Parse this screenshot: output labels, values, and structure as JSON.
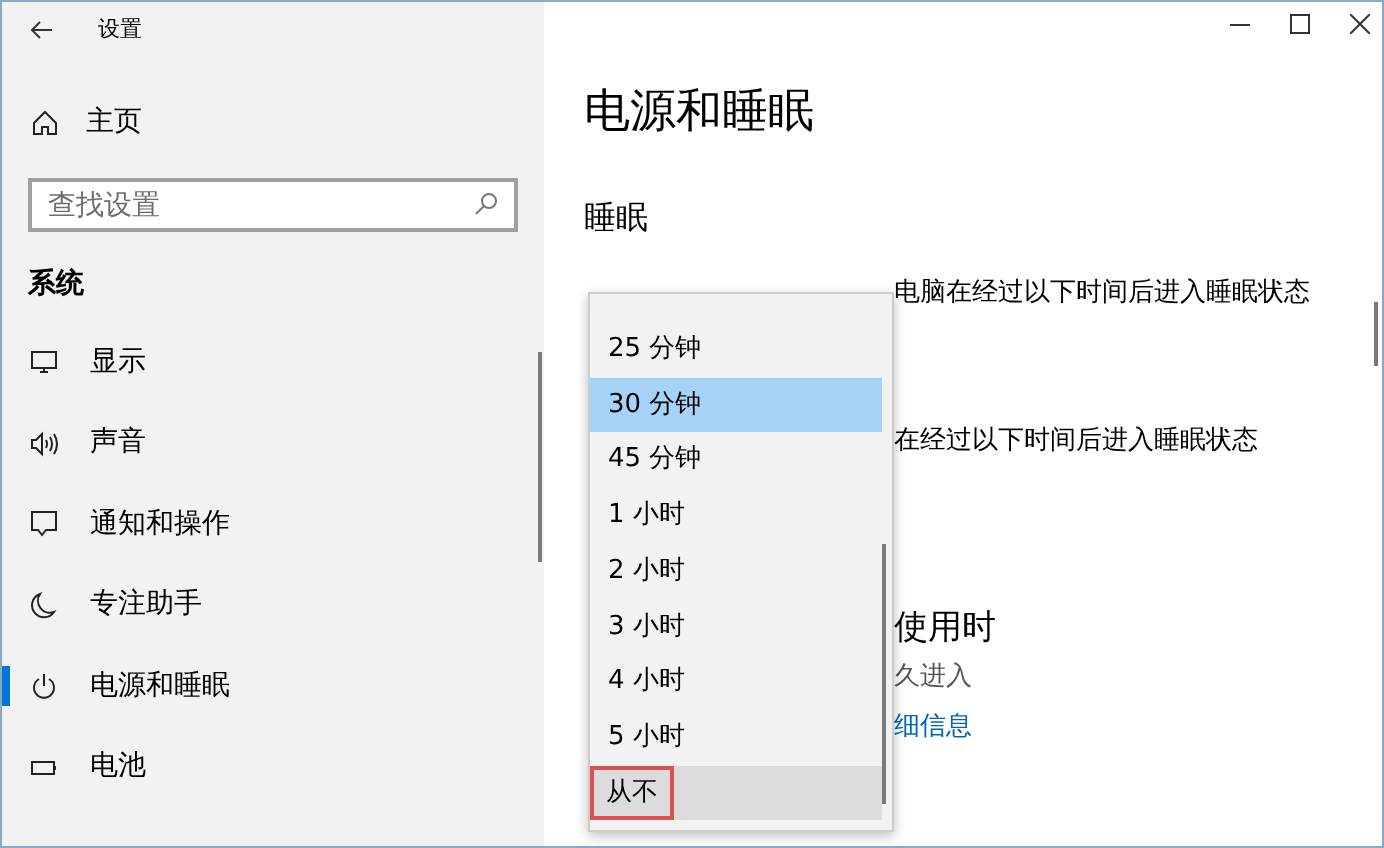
{
  "window": {
    "title": "设置"
  },
  "sidebar": {
    "home": "主页",
    "search": {
      "placeholder": "查找设置"
    },
    "section": "系统",
    "items": [
      {
        "label": "显示",
        "selected": false
      },
      {
        "label": "声音",
        "selected": false
      },
      {
        "label": "通知和操作",
        "selected": false
      },
      {
        "label": "专注助手",
        "selected": false
      },
      {
        "label": "电源和睡眠",
        "selected": true
      },
      {
        "label": "电池",
        "selected": false
      }
    ]
  },
  "main": {
    "title": "电源和睡眠",
    "section": "睡眠",
    "battery_text": "电脑在经过以下时间后进入睡眠状态",
    "plugged_text": "在经过以下时间后进入睡眠状态",
    "usage_heading": "使用时",
    "usage_text": "久进入",
    "link": "细信息"
  },
  "dropdown": {
    "options": [
      {
        "label": "25 分钟",
        "selected": false,
        "highlighted": false
      },
      {
        "label": "30 分钟",
        "selected": true,
        "highlighted": false
      },
      {
        "label": "45 分钟",
        "selected": false,
        "highlighted": false
      },
      {
        "label": "1 小时",
        "selected": false,
        "highlighted": false
      },
      {
        "label": "2 小时",
        "selected": false,
        "highlighted": false
      },
      {
        "label": "3 小时",
        "selected": false,
        "highlighted": false
      },
      {
        "label": "4 小时",
        "selected": false,
        "highlighted": false
      },
      {
        "label": "5 小时",
        "selected": false,
        "highlighted": false
      },
      {
        "label": "从不",
        "selected": false,
        "highlighted": true
      }
    ]
  }
}
